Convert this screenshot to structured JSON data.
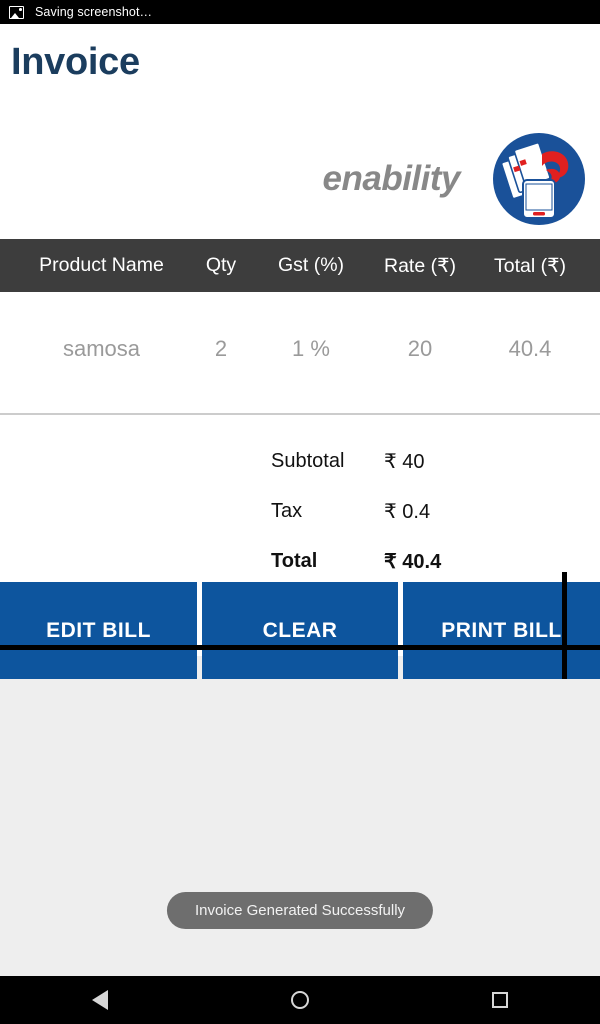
{
  "status_bar": {
    "icon": "image-screenshot-icon",
    "text": "Saving screenshot…"
  },
  "header": {
    "title": "Invoice",
    "title_color": "#1b3d5e",
    "brand_name": "enability",
    "brand_color": "#888888",
    "logo_icon": "enability-logo-icon"
  },
  "table": {
    "header_bg": "#3d3d3d",
    "columns": [
      "Product Name",
      "Qty",
      "Gst (%)",
      "Rate (₹)",
      "Total (₹)"
    ],
    "rows": [
      {
        "product_name": "samosa",
        "qty": "2",
        "gst": "1 %",
        "rate": "20",
        "total": "40.4"
      }
    ]
  },
  "summary": {
    "subtotal_label": "Subtotal",
    "subtotal_value": "₹ 40",
    "tax_label": "Tax",
    "tax_value": "₹ 0.4",
    "total_label": "Total",
    "total_value": "₹ 40.4"
  },
  "actions": {
    "accent_color": "#0d559e",
    "edit_bill": "EDIT BILL",
    "clear": "CLEAR",
    "print_bill": "PRINT BILL"
  },
  "toast": {
    "message": "Invoice Generated Successfully"
  },
  "nav_bar": {
    "back": "back-triangle-icon",
    "home": "home-circle-icon",
    "recents": "recents-square-icon"
  }
}
